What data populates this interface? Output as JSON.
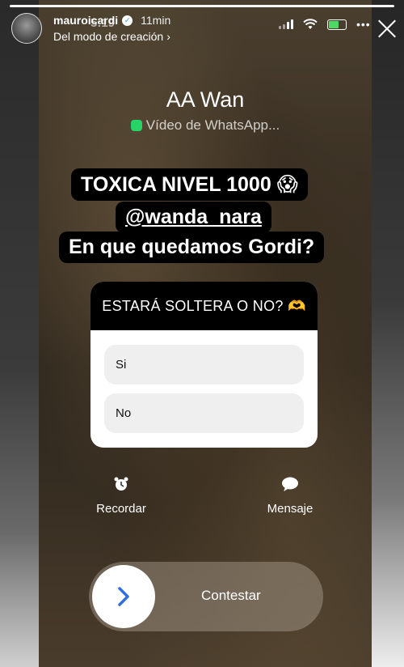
{
  "story": {
    "username": "mauroicardi",
    "time_ago": "11min",
    "subtitle": "Del modo de creación",
    "subtitle_chevron": "›"
  },
  "phone": {
    "time": "5:19",
    "wifi_icon": "wifi-icon",
    "dots": "•••"
  },
  "call": {
    "caller": "AA Wan",
    "subtitle": "Vídeo de WhatsApp..."
  },
  "caption": {
    "line1": "TOXICA NIVEL 1000 😱",
    "line2": "@wanda_nara",
    "line3": "En que quedamos Gordi?"
  },
  "poll": {
    "question": "ESTARÁ SOLTERA O NO? 🫶",
    "options": [
      "Si",
      "No"
    ]
  },
  "actions": {
    "remind": "Recordar",
    "message": "Mensaje"
  },
  "slider": {
    "label": "Contestar"
  }
}
